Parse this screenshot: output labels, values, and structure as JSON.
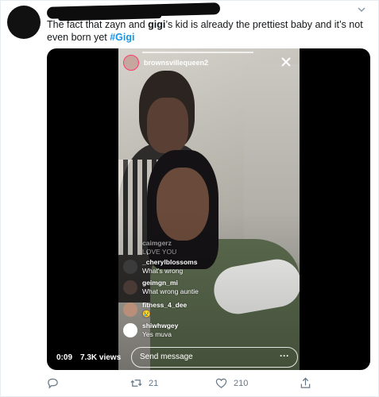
{
  "tweet": {
    "text_parts": {
      "t1": "The fact that zayn and ",
      "t2": "gigi",
      "t3": "’s kid is already the prettiest baby and it’s not even born yet ",
      "hashtag": "#Gigi"
    },
    "actions": {
      "retweet_count": "21",
      "like_count": "210"
    }
  },
  "video": {
    "elapsed": "0:09",
    "views": "7.3K views"
  },
  "instagram": {
    "username": "brownsvillequeen2",
    "comments": [
      {
        "user": "caimgerz",
        "message": "LOVE YOU"
      },
      {
        "user": "_cherylblossoms",
        "message": "What's wrong"
      },
      {
        "user": "geimgn_mi",
        "message": "What wrong auntie"
      },
      {
        "user": "fitness_4_dee",
        "message": "😢"
      },
      {
        "user": "shiwhwgey",
        "message": "Yes muva"
      }
    ],
    "send_placeholder": "Send message",
    "more_glyph": "···"
  },
  "colors": {
    "text": "#14171a",
    "hashtag": "#1b95e0",
    "muted": "#657786"
  },
  "icons": [
    "chevron-down-icon",
    "close-icon",
    "reply-icon",
    "retweet-icon",
    "like-icon",
    "share-icon"
  ]
}
